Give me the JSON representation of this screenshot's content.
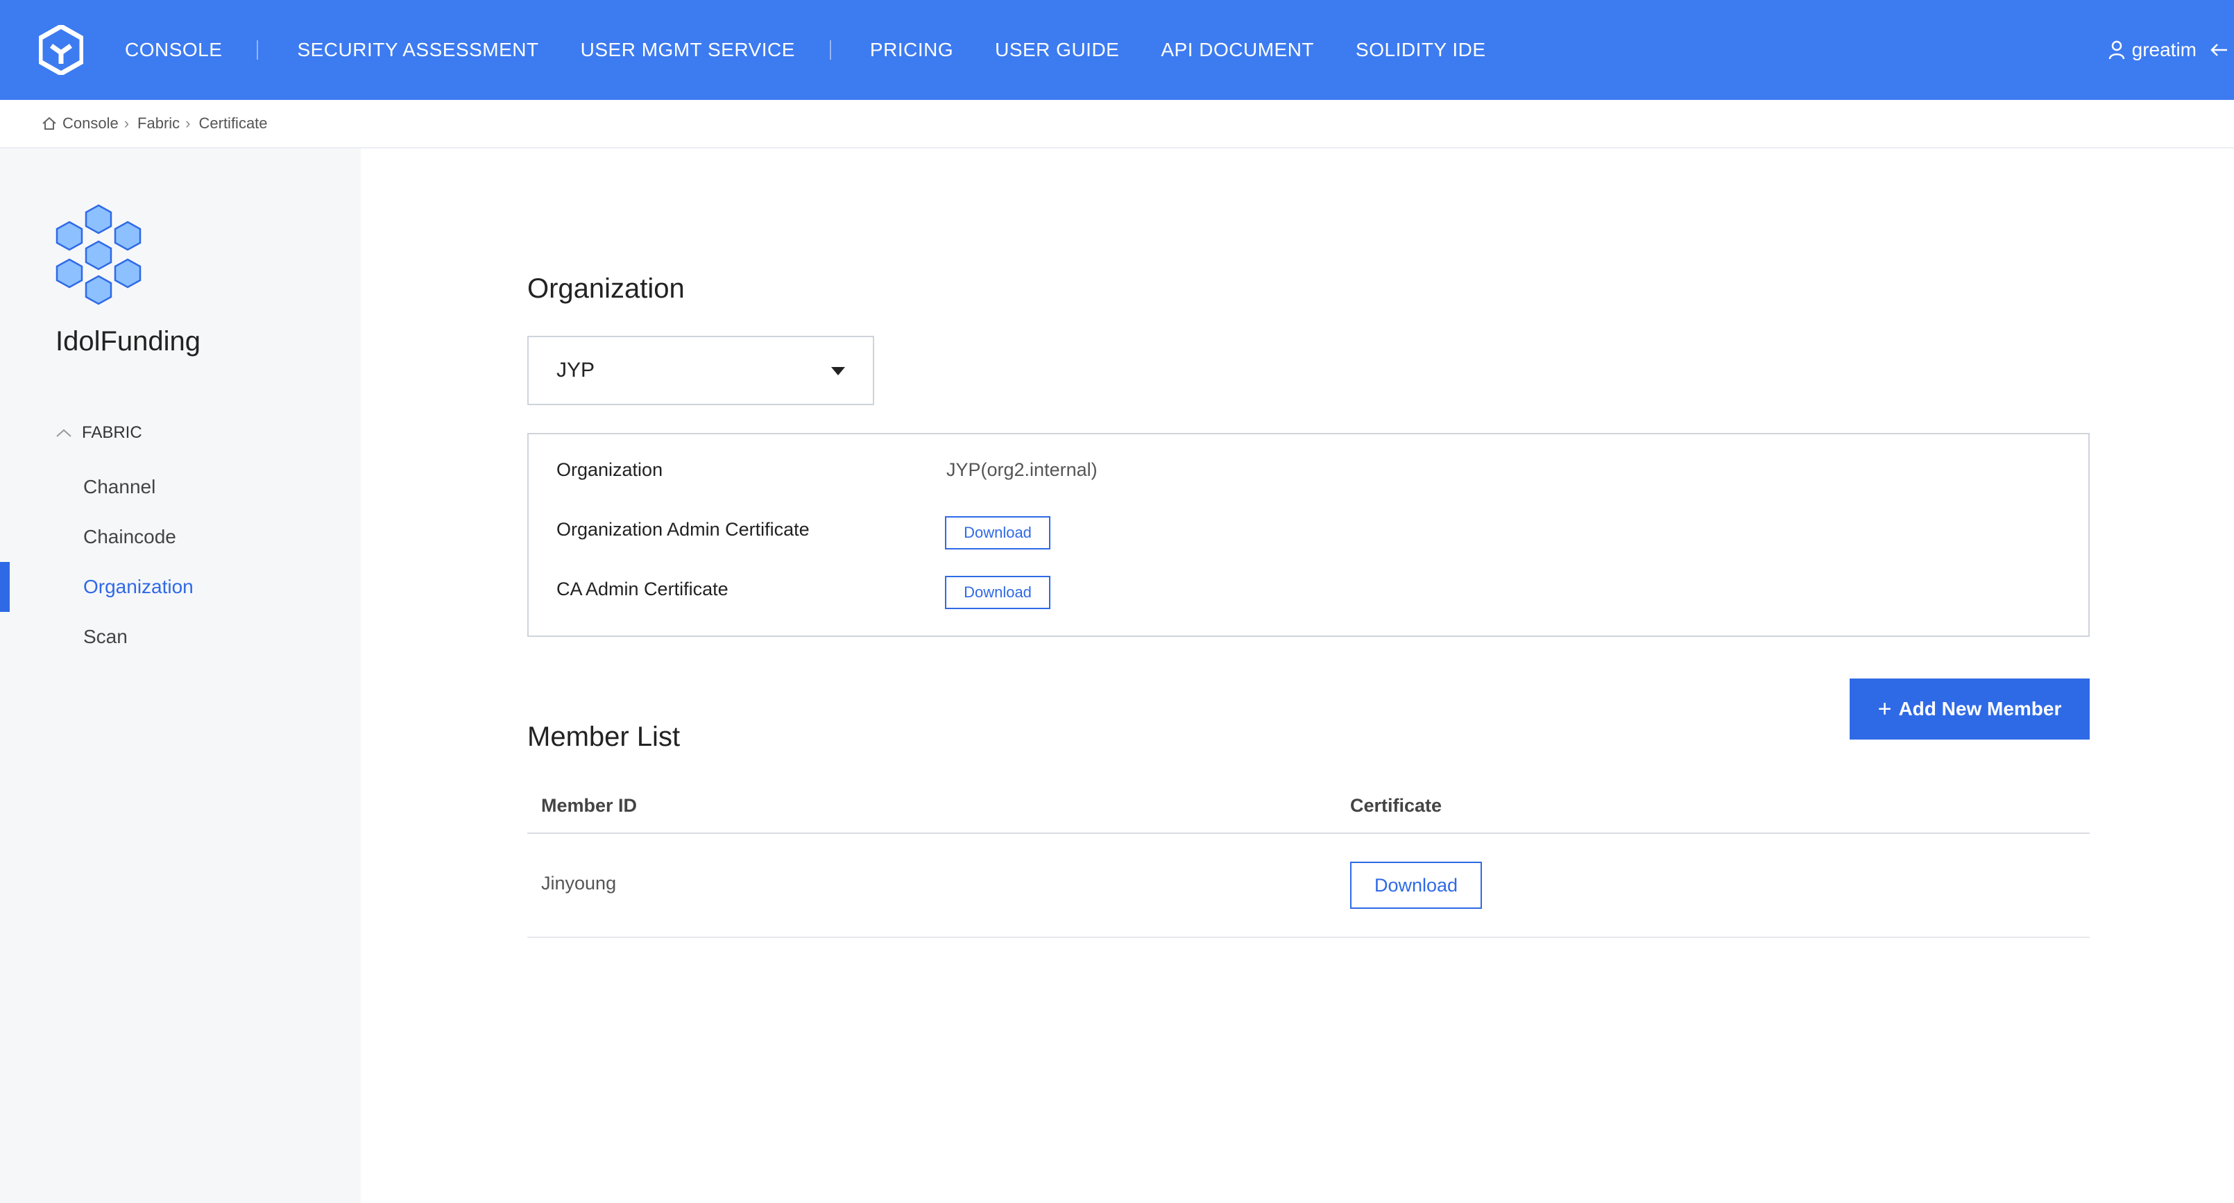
{
  "topbar": {
    "nav": [
      {
        "label": "CONSOLE"
      },
      {
        "label": "SECURITY ASSESSMENT"
      },
      {
        "label": "USER MGMT SERVICE"
      },
      {
        "label": "PRICING"
      },
      {
        "label": "USER GUIDE"
      },
      {
        "label": "API DOCUMENT"
      },
      {
        "label": "SOLIDITY IDE"
      }
    ],
    "user": "greatim",
    "brand_color": "#3d7bf0"
  },
  "breadcrumb": [
    "Console",
    "Fabric",
    "Certificate"
  ],
  "sidebar": {
    "project_name": "IdolFunding",
    "section": "FABRIC",
    "items": [
      {
        "label": "Channel"
      },
      {
        "label": "Chaincode"
      },
      {
        "label": "Organization"
      },
      {
        "label": "Scan"
      }
    ],
    "active_item": "Organization"
  },
  "main": {
    "organization_heading": "Organization",
    "org_select": {
      "value": "JYP"
    },
    "info": {
      "org_label": "Organization",
      "org_value": "JYP(org2.internal)",
      "admin_cert_label": "Organization Admin Certificate",
      "ca_admin_cert_label": "CA Admin Certificate",
      "download_label": "Download"
    },
    "add_member_label": "Add New Member",
    "member_list_heading": "Member List",
    "table": {
      "columns": [
        "Member ID",
        "Certificate"
      ],
      "rows": [
        {
          "member_id": "Jinyoung",
          "certificate": "Download"
        }
      ]
    }
  },
  "accent_color": "#2f6ae6"
}
